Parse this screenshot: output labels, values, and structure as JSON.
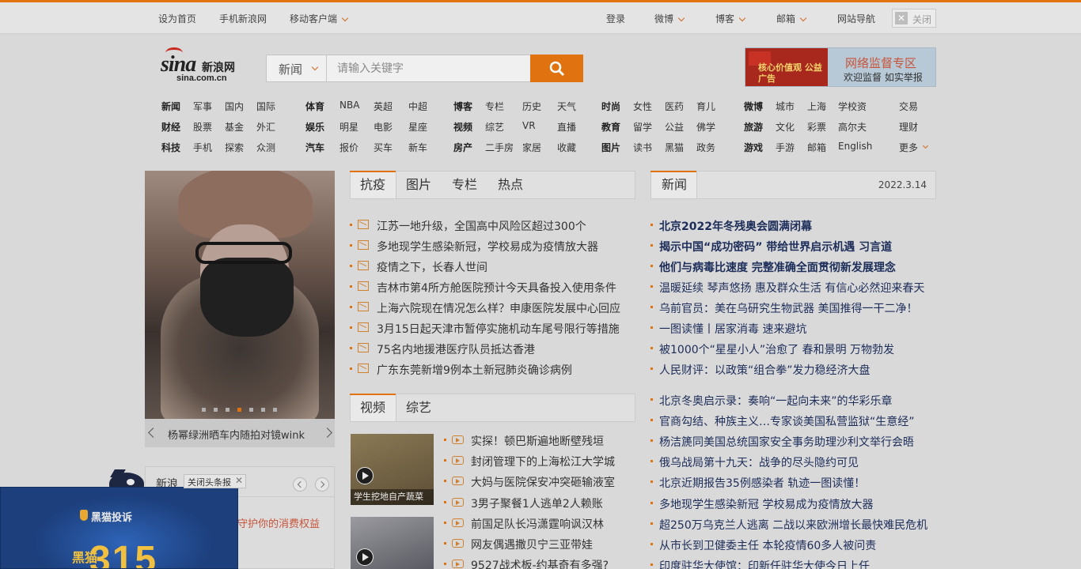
{
  "topbar": {
    "left": [
      "设为首页",
      "手机新浪网",
      "移动客户端"
    ],
    "login": "登录",
    "weibo": "微博",
    "blog": "博客",
    "mail": "邮箱",
    "sitemap": "网站导航",
    "close": "关闭"
  },
  "logo": {
    "sina": "sina",
    "cn_name": "新浪网",
    "domain": "sina.com.cn"
  },
  "search": {
    "category": "新闻",
    "placeholder": "请输入关键字"
  },
  "banner": {
    "left_text": "核心价值观 公益广告",
    "title": "网络监督专区",
    "subtitle": "欢迎监督 如实举报"
  },
  "nav": {
    "groups": [
      {
        "rows": [
          [
            "新闻",
            "军事",
            "国内",
            "国际"
          ],
          [
            "财经",
            "股票",
            "基金",
            "外汇"
          ],
          [
            "科技",
            "手机",
            "探索",
            "众测"
          ]
        ]
      },
      {
        "rows": [
          [
            "体育",
            "NBA",
            "英超",
            "中超"
          ],
          [
            "娱乐",
            "明星",
            "电影",
            "星座"
          ],
          [
            "汽车",
            "报价",
            "买车",
            "新车"
          ]
        ]
      },
      {
        "rows": [
          [
            "博客",
            "专栏",
            "历史",
            "天气"
          ],
          [
            "视频",
            "综艺",
            "VR",
            "直播"
          ],
          [
            "房产",
            "二手房",
            "家居",
            "收藏"
          ]
        ]
      },
      {
        "rows": [
          [
            "时尚",
            "女性",
            "医药",
            "育儿"
          ],
          [
            "教育",
            "留学",
            "公益",
            "佛学"
          ],
          [
            "图片",
            "读书",
            "黑猫",
            "政务"
          ]
        ]
      },
      {
        "rows": [
          [
            "微博",
            "城市",
            "上海",
            "学校资"
          ],
          [
            "旅游",
            "文化",
            "彩票",
            "高尔夫"
          ],
          [
            "游戏",
            "手游",
            "邮箱",
            "English"
          ]
        ]
      },
      {
        "rows": [
          [
            "交易"
          ],
          [
            "理财"
          ],
          [
            "更多"
          ]
        ]
      }
    ]
  },
  "slider": {
    "caption": "杨幂绿洲晒车内随拍对镜wink",
    "slide_count": 7,
    "active_slide": 3
  },
  "tabs1": {
    "items": [
      "抗疫",
      "图片",
      "专栏",
      "热点"
    ]
  },
  "list1": [
    "江苏一地升级，全国高中风险区超过300个",
    "多地现学生感染新冠，学校易成为疫情放大器",
    "疫情之下，长春人世间",
    "吉林市第4所方舱医院预计今天具备投入使用条件",
    "上海六院现在情况怎么样？申康医院发展中心回应",
    "3月15日起天津市暂停实施机动车尾号限行等措施",
    "75名内地援港医疗队员抵达香港",
    "广东东莞新增9例本土新冠肺炎确诊病例"
  ],
  "tabs2": {
    "items": [
      "视频",
      "综艺"
    ]
  },
  "video_thumbs": [
    "学生挖地自产蔬菜",
    ""
  ],
  "list2": [
    "实探！顿巴斯遍地断壁残垣",
    "封闭管理下的上海松江大学城",
    "大妈与医院保安冲突砸输液室",
    "3男子聚餐1人逃单2人赖账",
    "前国足队长冯潇霆响讽汉林",
    "网友偶遇撒贝宁三亚带娃",
    "9527战术板-约基奇有多强?"
  ],
  "news_tab": {
    "label": "新闻",
    "date": "2022.3.14"
  },
  "news_bold": [
    "北京2022年冬残奥会圆满闭幕",
    "揭示中国“成功密码” 带给世界启示机遇 习言道",
    "他们与病毒比速度 完整准确全面贯彻新发展理念"
  ],
  "news_list": [
    "温暖延续 琴声悠扬 惠及群众生活 有信心必然迎来春天",
    "乌前官员：美在乌研究生物武器 美国推得一干二净！",
    "一图读懂丨居家消毒 速来避坑",
    "被1000个“星星小人”治愈了 春和景明 万物勃发",
    "人民财评：以政策“组合拳”发力稳经济大盘"
  ],
  "news_list2": [
    "北京冬奥启示录：奏响“一起向未来”的华彩乐章",
    "官商勾结、种族主义…专家谈美国私营监狱“生意经”",
    "杨洁篪同美国总统国家安全事务助理沙利文举行会晤",
    "俄乌战局第十九天：战争的尽头隐约可见",
    "北京近期报告35例感染者 轨迹一图读懂！",
    "多地现学生感染新冠 学校易成为疫情放大器",
    "超250万乌克兰人逃离 二战以来欧洲增长最快难民危机",
    "从市长到卫健委主任 本轮疫情60多人被问责",
    "印度驻华大使馆：印新任驻华大使今日上任"
  ],
  "bottom_box": {
    "title": "新浪",
    "line": "守护你的消费权益"
  },
  "ad": {
    "brand": "黑猫投诉",
    "big": "315",
    "small": "黑猫",
    "close_label": "关闭头条报"
  },
  "colors": {
    "accent": "#e0720f",
    "link_blue": "#1c2d5a"
  }
}
